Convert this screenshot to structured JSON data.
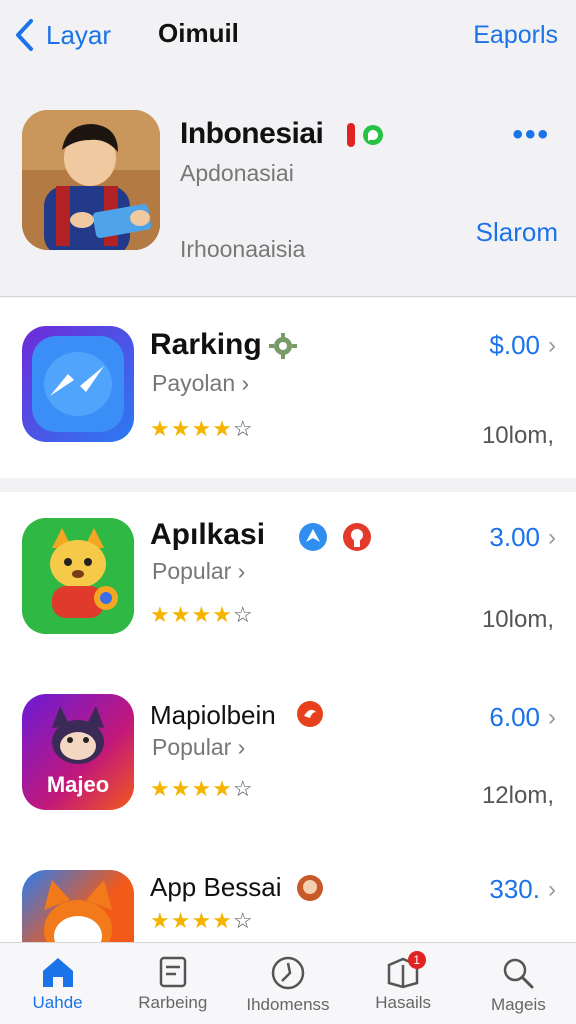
{
  "navbar": {
    "back_label": "Layar",
    "title": "Oimuil",
    "right_label": "Eaporls"
  },
  "featured": {
    "title": "Inbonesiai",
    "subtitle": "Apdonasiai",
    "footer": "Irhoonaaisia",
    "action_label": "Slarom",
    "more_label": "•••"
  },
  "apps": [
    {
      "name": "Rarking",
      "category": "Payolan ›",
      "rating": 4,
      "price": "$.00",
      "size": "10lom,"
    },
    {
      "name": "Apılkasi",
      "category": "Popular ›",
      "rating": 4,
      "price": "3.00",
      "size": "10lom,"
    },
    {
      "name": "Mapiolbein",
      "category": "Popular ›",
      "rating": 4,
      "price": "6.00",
      "size": "12lom,",
      "icon_text": "Majeo"
    },
    {
      "name": "App Bessai",
      "category": "",
      "rating": 4,
      "price": "330.",
      "size": ""
    }
  ],
  "tabs": [
    {
      "label": "Uahde",
      "icon": "house-icon",
      "active": true
    },
    {
      "label": "Rarbeing",
      "icon": "document-icon",
      "active": false
    },
    {
      "label": "Ihdomenss",
      "icon": "compass-icon",
      "active": false
    },
    {
      "label": "Hasails",
      "icon": "layers-icon",
      "active": false,
      "badge": "1"
    },
    {
      "label": "Mageis",
      "icon": "search-icon",
      "active": false
    }
  ],
  "colors": {
    "accent": "#1a73e8",
    "star": "#f4b400",
    "background": "#f2f2f5"
  }
}
